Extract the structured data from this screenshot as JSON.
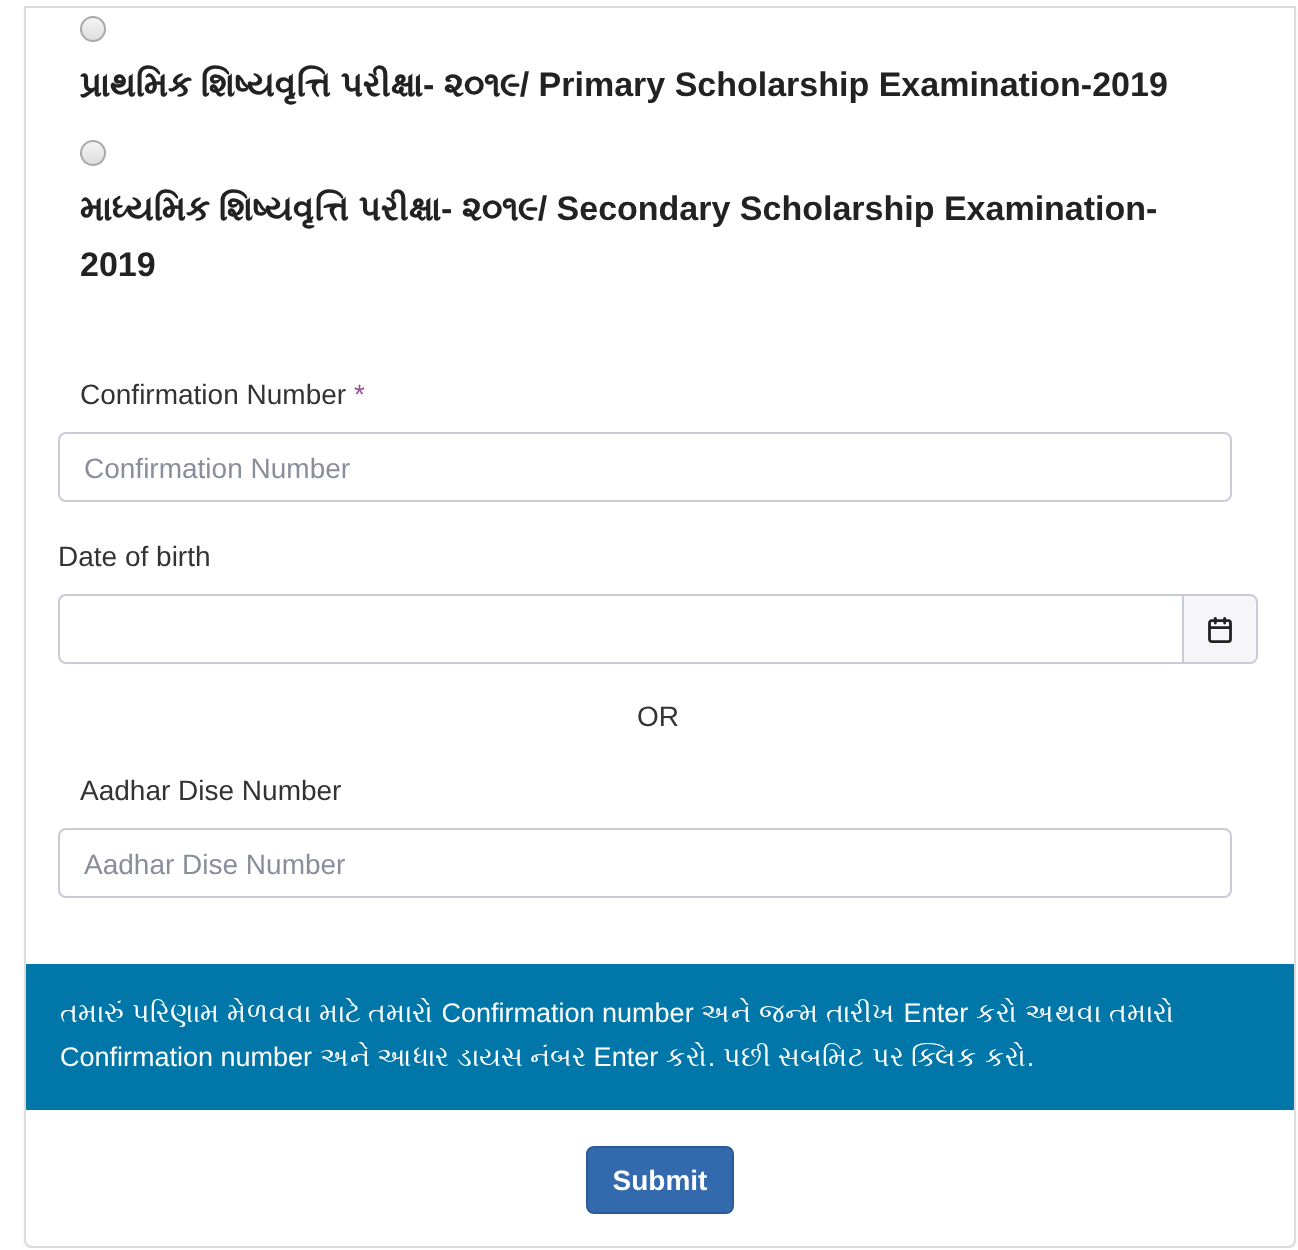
{
  "exam_options": [
    {
      "label": "પ્રાથમિક શિષ્યવૃત્તિ પરીક્ષા- ૨૦૧૯/ Primary Scholarship Examination-2019",
      "selected": false
    },
    {
      "label": "માધ્યમિક શિષ્યવૃત્તિ પરીક્ષા- ૨૦૧૯/ Secondary Scholarship Examination-2019",
      "selected": false
    }
  ],
  "fields": [
    {
      "kind": "text",
      "label": "Confirmation Number",
      "required_mark": "*",
      "placeholder": "Confirmation Number"
    },
    {
      "kind": "date",
      "label": "Date of birth"
    },
    {
      "kind": "separator",
      "label": "OR"
    },
    {
      "kind": "text",
      "label": "Aadhar Dise Number",
      "placeholder": "Aadhar Dise Number"
    }
  ],
  "info_message": "તમારું પરિણામ મેળવવા માટે તમારો Confirmation number અને જન્મ તારીખ Enter કરો અથવા તમારો Confirmation number અને આધાર ડાયસ નંબર Enter કરો. પછી સબમિટ પર ક્લિક કરો.",
  "submit_button": "Submit"
}
